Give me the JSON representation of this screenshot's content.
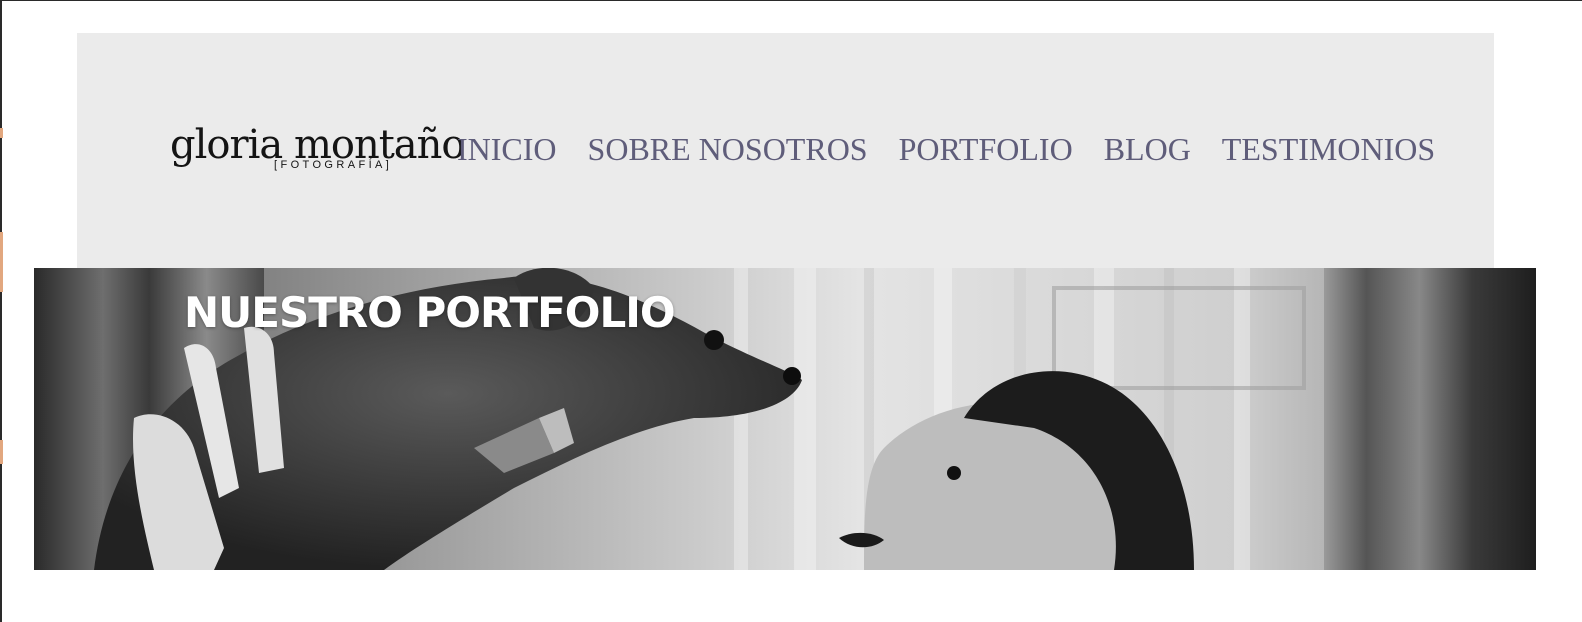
{
  "logo": {
    "name": "gloria montaño",
    "tagline": "[FOTOGRAFÍA]"
  },
  "nav": {
    "items": [
      {
        "label": "INICIO"
      },
      {
        "label": "SOBRE NOSOTROS"
      },
      {
        "label": "PORTFOLIO"
      },
      {
        "label": "BLOG"
      },
      {
        "label": "TESTIMONIOS"
      }
    ]
  },
  "hero": {
    "title": "NUESTRO PORTFOLIO",
    "image": "black-and-white photo of a woman looking up at a small dog held aloft"
  },
  "colors": {
    "header_bg": "#ebebeb",
    "nav_text": "#5f5d7a",
    "logo_text": "#141414",
    "hero_title": "#ffffff"
  }
}
